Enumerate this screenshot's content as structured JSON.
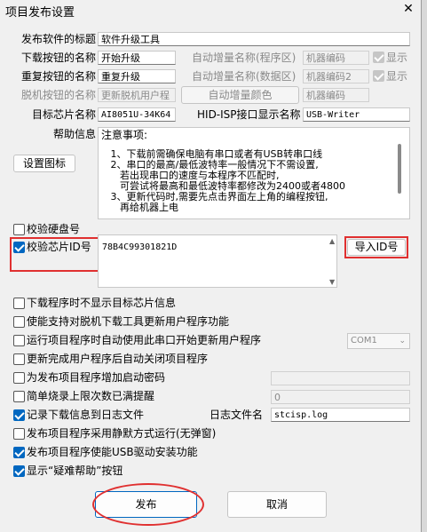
{
  "window": {
    "title": "项目发布设置",
    "close_glyph": "✕"
  },
  "fields": {
    "publish_title_label": "发布软件的标题",
    "publish_title_value": "软件升级工具",
    "download_btn_label": "下载按钮的名称",
    "download_btn_value": "开始升级",
    "reset_btn_label": "重复按钮的名称",
    "reset_btn_value": "重复升级",
    "offline_btn_label": "脱机按钮的名称",
    "offline_btn_value": "更新脱机用户程",
    "auto_inc_prog": "自动增量名称(程序区)",
    "auto_inc_prog_value": "机器编码",
    "auto_inc_data": "自动增量名称(数据区)",
    "auto_inc_data_value": "机器编码2",
    "auto_inc_color": "自动增量颜色",
    "auto_inc_color_value": "机器编码",
    "show_label": "显示",
    "target_chip_label": "目标芯片名称",
    "target_chip_value": "AI8051U-34K64",
    "hid_label": "HID-ISP接口显示名称",
    "hid_value": "USB-Writer"
  },
  "help": {
    "label": "帮助信息",
    "set_icon_button": "设置图标",
    "lines": [
      "注意事项:",
      "   1、下载前需确保电脑有串口或者有USB转串口线",
      "   2、串口的最高/最低波特率一般情况下不需设置,",
      "      若出现串口的速度与本程序不匹配时,",
      "      可尝试将最高和最低波特率都修改为2400或者4800",
      "   3、更新代码时,需要先点击界面左上角的编程按钮,",
      "      再给机器上电"
    ]
  },
  "verify": {
    "disk_label": "校验硬盘号",
    "chip_id_label": "校验芯片ID号",
    "chip_id_value": "78B4C99301821D",
    "import_id_button": "导入ID号"
  },
  "options": [
    {
      "label": "下载程序时不显示目标芯片信息",
      "checked": false
    },
    {
      "label": "使能支持对脱机下载工具更新用户程序功能",
      "checked": false
    },
    {
      "label": "运行项目程序时自动使用此串口开始更新用户程序",
      "checked": false
    },
    {
      "label": "更新完成用户程序后自动关闭项目程序",
      "checked": false
    },
    {
      "label": "为发布项目程序增加启动密码",
      "checked": false
    },
    {
      "label": "简单烧录上限次数已满提醒",
      "checked": false
    },
    {
      "label": "记录下载信息到日志文件",
      "checked": true
    },
    {
      "label": "发布项目程序采用静默方式运行(无弹窗)",
      "checked": false
    },
    {
      "label": "发布项目程序使能USB驱动安装功能",
      "checked": true
    },
    {
      "label": "显示“疑难帮助”按钮",
      "checked": true
    }
  ],
  "com_port": "COM1",
  "count_value": "0",
  "log_file_label": "日志文件名",
  "log_file_value": "stcisp.log",
  "buttons": {
    "publish": "发布",
    "cancel": "取消"
  }
}
